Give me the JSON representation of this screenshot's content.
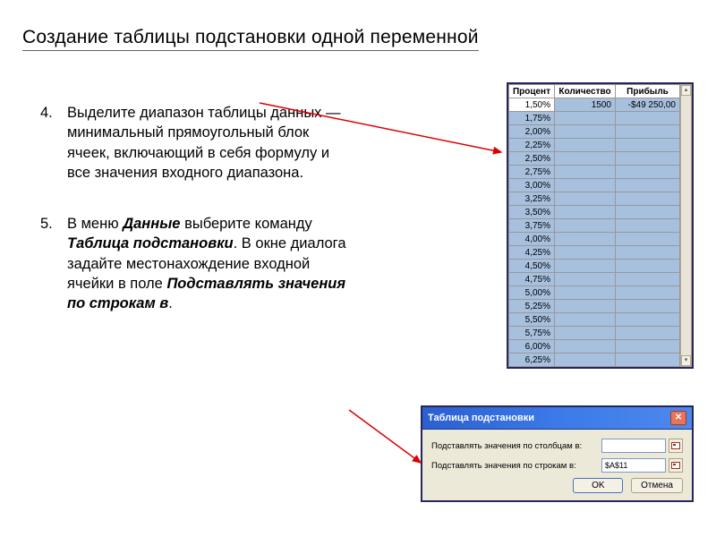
{
  "title": "Создание таблицы подстановки одной переменной",
  "instructions": [
    {
      "num": "4.",
      "plain": "Выделите диапазон таблицы данных — минимальный прямоугольный блок ячеек, включающий в себя формулу и все значения входного диапазона."
    },
    {
      "num": "5.",
      "pre": "В меню ",
      "b1": "Данные",
      "mid1": " выберите команду ",
      "b2": "Таблица подстановки",
      "mid2": ". В окне диалога задайте местонахождение входной ячейки в поле ",
      "b3": "Подставлять значения по строкам в",
      "post": "."
    }
  ],
  "sheet": {
    "headers": [
      "Процент",
      "Количество",
      "Прибыль"
    ],
    "first_row": {
      "percent": "1,50%",
      "qty": "1500",
      "profit": "-$49 250,00"
    },
    "percents": [
      "1,75%",
      "2,00%",
      "2,25%",
      "2,50%",
      "2,75%",
      "3,00%",
      "3,25%",
      "3,50%",
      "3,75%",
      "4,00%",
      "4,25%",
      "4,50%",
      "4,75%",
      "5,00%",
      "5,25%",
      "5,50%",
      "5,75%",
      "6,00%",
      "6,25%"
    ]
  },
  "dialog": {
    "title": "Таблица подстановки",
    "row1_label": "Подставлять значения по столбцам в:",
    "row1_value": "",
    "row2_label": "Подставлять значения по строкам в:",
    "row2_value": "$A$11",
    "ok": "OK",
    "cancel": "Отмена"
  }
}
